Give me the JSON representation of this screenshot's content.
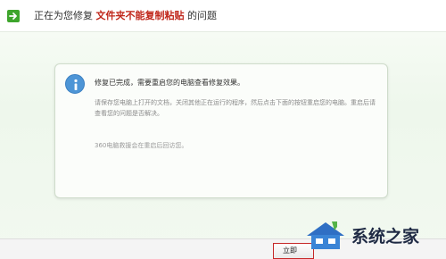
{
  "header": {
    "prefix": "正在为您修复",
    "highlight": "文件夹不能复制粘贴",
    "suffix": "的问题",
    "highlight_color": "#c0271b"
  },
  "message": {
    "icon": "info-icon",
    "title": "修复已完成，需要重启您的电脑查看修复效果。",
    "body": "请保存您电脑上打开的文档，关闭其他正在运行的程序，然后点击下面的按钮重启您的电脑。重启后请查看您的问题是否解决。",
    "footnote": "360电脑救援会在重启后回访您。"
  },
  "footer": {
    "restart_label": "立即"
  },
  "watermark": {
    "text": "系统之家"
  },
  "colors": {
    "accent_green": "#3ea52c",
    "info_blue": "#4d95d6",
    "button_border": "#c62828"
  }
}
